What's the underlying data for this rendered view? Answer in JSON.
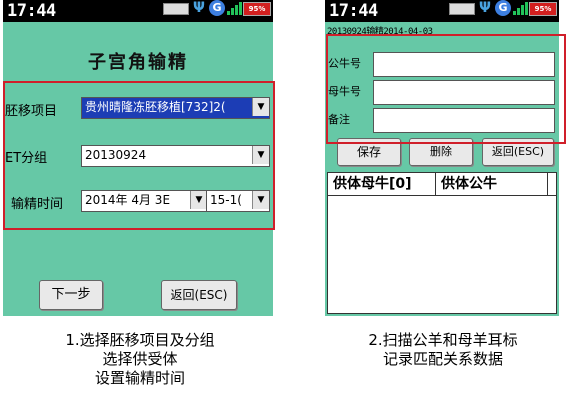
{
  "status": {
    "time": "17:44",
    "battery": "95%"
  },
  "screen1": {
    "title": "子宫角输精",
    "embryo_project_label": "胚移项目",
    "embryo_project_value": "贵州晴隆冻胚移植[732]2(",
    "et_group_label": "ET分组",
    "et_group_value": "20130924",
    "insem_time_label": "输精时间",
    "insem_date_value": "2014年 4月 3E",
    "insem_hour_value": "15-1(",
    "next_button": "下一步",
    "back_button": "返回(ESC)"
  },
  "screen2": {
    "info_line": "20130924输精2014-04-03",
    "ram_label": "公牛号",
    "ewe_label": "母牛号",
    "note_label": "备注",
    "ram_value": "",
    "ewe_value": "",
    "note_value": "",
    "save_button": "保存",
    "delete_button": "删除",
    "back_button": "返回(ESC)",
    "list_col1": "供体母牛[0]",
    "list_col2": "供体公牛"
  },
  "captions": {
    "left_line1": "1.选择胚移项目及分组",
    "left_line2": "选择供受体",
    "left_line3": "设置输精时间",
    "right_line1": "2.扫描公羊和母羊耳标",
    "right_line2": "记录匹配关系数据"
  },
  "colors": {
    "screen_bg": "#66c8a6",
    "highlight_border": "#d01f2a",
    "selection_blue": "#1c3db5"
  }
}
